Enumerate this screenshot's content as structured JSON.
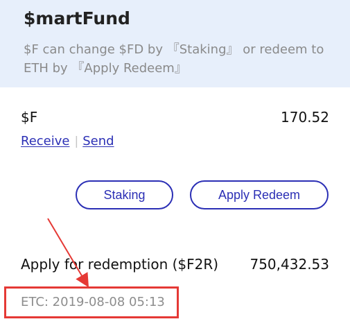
{
  "header": {
    "brand": "$martFund",
    "subtitle": "$F can change $FD by 『Staking』 or redeem to ETH by 『Apply Redeem』"
  },
  "asset": {
    "label": "$F",
    "value": "170.52",
    "receive_label": "Receive",
    "separator": "|",
    "send_label": "Send"
  },
  "actions": {
    "staking_label": "Staking",
    "apply_redeem_label": "Apply Redeem"
  },
  "redemption": {
    "label": "Apply for redemption ($F2R)",
    "value": "750,432.53",
    "etc_label": "ETC: 2019-08-08 05:13"
  },
  "colors": {
    "header_bg": "#e7effb",
    "link_blue": "#2b2fb5",
    "annotation_red": "#e53935",
    "muted_text": "#8d8d8d"
  }
}
